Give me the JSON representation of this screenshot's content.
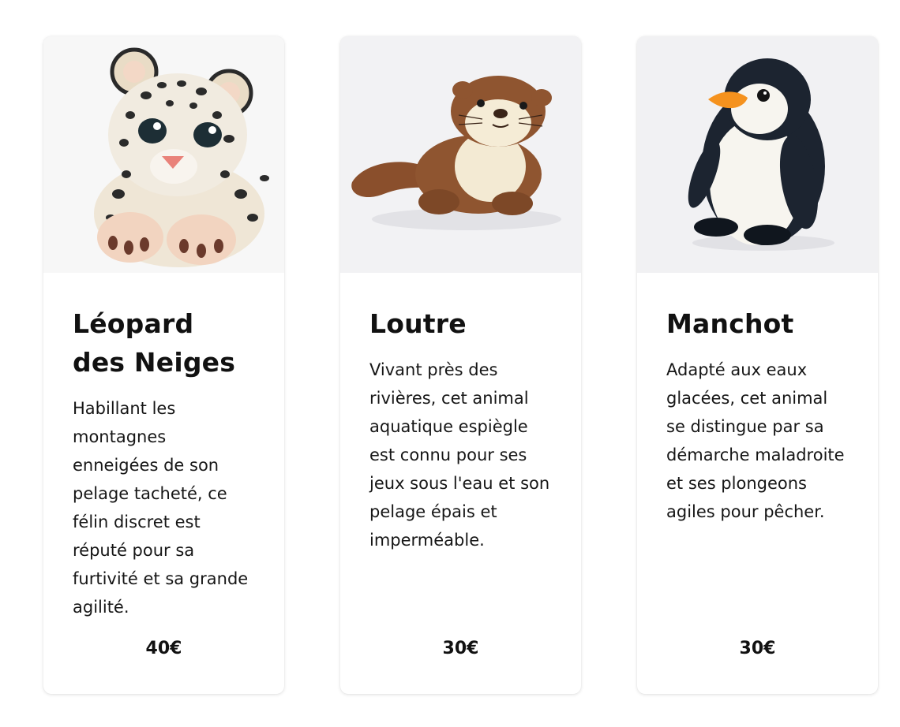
{
  "products": [
    {
      "title": "Léopard des Neiges",
      "description": "Habillant les montagnes enneigées de son pelage tacheté, ce félin discret est réputé pour sa furtivité et sa grande agilité.",
      "price": "40€",
      "image_icon": "snow-leopard-plush-image"
    },
    {
      "title": "Loutre",
      "description": "Vivant près des rivières, cet animal aquatique espiègle est connu pour ses jeux sous l'eau et son pelage épais et imperméable.",
      "price": "30€",
      "image_icon": "otter-plush-image"
    },
    {
      "title": "Manchot",
      "description": "Adapté aux eaux glacées, cet animal se distingue par sa démarche maladroite et ses plongeons agiles pour pêcher.",
      "price": "30€",
      "image_icon": "penguin-plush-image"
    }
  ],
  "colors": {
    "card_background": "#ffffff",
    "image_background": "#f3f3f5",
    "text": "#111111"
  }
}
